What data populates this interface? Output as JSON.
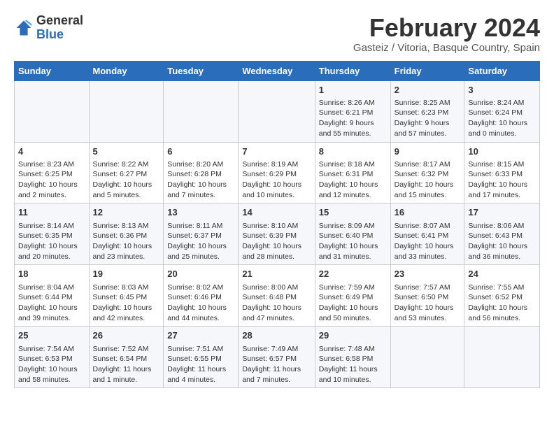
{
  "header": {
    "logo": {
      "general": "General",
      "blue": "Blue"
    },
    "title": "February 2024",
    "location": "Gasteiz / Vitoria, Basque Country, Spain"
  },
  "weekdays": [
    "Sunday",
    "Monday",
    "Tuesday",
    "Wednesday",
    "Thursday",
    "Friday",
    "Saturday"
  ],
  "weeks": [
    [
      {
        "day": "",
        "info": ""
      },
      {
        "day": "",
        "info": ""
      },
      {
        "day": "",
        "info": ""
      },
      {
        "day": "",
        "info": ""
      },
      {
        "day": "1",
        "info": "Sunrise: 8:26 AM\nSunset: 6:21 PM\nDaylight: 9 hours\nand 55 minutes."
      },
      {
        "day": "2",
        "info": "Sunrise: 8:25 AM\nSunset: 6:23 PM\nDaylight: 9 hours\nand 57 minutes."
      },
      {
        "day": "3",
        "info": "Sunrise: 8:24 AM\nSunset: 6:24 PM\nDaylight: 10 hours\nand 0 minutes."
      }
    ],
    [
      {
        "day": "4",
        "info": "Sunrise: 8:23 AM\nSunset: 6:25 PM\nDaylight: 10 hours\nand 2 minutes."
      },
      {
        "day": "5",
        "info": "Sunrise: 8:22 AM\nSunset: 6:27 PM\nDaylight: 10 hours\nand 5 minutes."
      },
      {
        "day": "6",
        "info": "Sunrise: 8:20 AM\nSunset: 6:28 PM\nDaylight: 10 hours\nand 7 minutes."
      },
      {
        "day": "7",
        "info": "Sunrise: 8:19 AM\nSunset: 6:29 PM\nDaylight: 10 hours\nand 10 minutes."
      },
      {
        "day": "8",
        "info": "Sunrise: 8:18 AM\nSunset: 6:31 PM\nDaylight: 10 hours\nand 12 minutes."
      },
      {
        "day": "9",
        "info": "Sunrise: 8:17 AM\nSunset: 6:32 PM\nDaylight: 10 hours\nand 15 minutes."
      },
      {
        "day": "10",
        "info": "Sunrise: 8:15 AM\nSunset: 6:33 PM\nDaylight: 10 hours\nand 17 minutes."
      }
    ],
    [
      {
        "day": "11",
        "info": "Sunrise: 8:14 AM\nSunset: 6:35 PM\nDaylight: 10 hours\nand 20 minutes."
      },
      {
        "day": "12",
        "info": "Sunrise: 8:13 AM\nSunset: 6:36 PM\nDaylight: 10 hours\nand 23 minutes."
      },
      {
        "day": "13",
        "info": "Sunrise: 8:11 AM\nSunset: 6:37 PM\nDaylight: 10 hours\nand 25 minutes."
      },
      {
        "day": "14",
        "info": "Sunrise: 8:10 AM\nSunset: 6:39 PM\nDaylight: 10 hours\nand 28 minutes."
      },
      {
        "day": "15",
        "info": "Sunrise: 8:09 AM\nSunset: 6:40 PM\nDaylight: 10 hours\nand 31 minutes."
      },
      {
        "day": "16",
        "info": "Sunrise: 8:07 AM\nSunset: 6:41 PM\nDaylight: 10 hours\nand 33 minutes."
      },
      {
        "day": "17",
        "info": "Sunrise: 8:06 AM\nSunset: 6:43 PM\nDaylight: 10 hours\nand 36 minutes."
      }
    ],
    [
      {
        "day": "18",
        "info": "Sunrise: 8:04 AM\nSunset: 6:44 PM\nDaylight: 10 hours\nand 39 minutes."
      },
      {
        "day": "19",
        "info": "Sunrise: 8:03 AM\nSunset: 6:45 PM\nDaylight: 10 hours\nand 42 minutes."
      },
      {
        "day": "20",
        "info": "Sunrise: 8:02 AM\nSunset: 6:46 PM\nDaylight: 10 hours\nand 44 minutes."
      },
      {
        "day": "21",
        "info": "Sunrise: 8:00 AM\nSunset: 6:48 PM\nDaylight: 10 hours\nand 47 minutes."
      },
      {
        "day": "22",
        "info": "Sunrise: 7:59 AM\nSunset: 6:49 PM\nDaylight: 10 hours\nand 50 minutes."
      },
      {
        "day": "23",
        "info": "Sunrise: 7:57 AM\nSunset: 6:50 PM\nDaylight: 10 hours\nand 53 minutes."
      },
      {
        "day": "24",
        "info": "Sunrise: 7:55 AM\nSunset: 6:52 PM\nDaylight: 10 hours\nand 56 minutes."
      }
    ],
    [
      {
        "day": "25",
        "info": "Sunrise: 7:54 AM\nSunset: 6:53 PM\nDaylight: 10 hours\nand 58 minutes."
      },
      {
        "day": "26",
        "info": "Sunrise: 7:52 AM\nSunset: 6:54 PM\nDaylight: 11 hours\nand 1 minute."
      },
      {
        "day": "27",
        "info": "Sunrise: 7:51 AM\nSunset: 6:55 PM\nDaylight: 11 hours\nand 4 minutes."
      },
      {
        "day": "28",
        "info": "Sunrise: 7:49 AM\nSunset: 6:57 PM\nDaylight: 11 hours\nand 7 minutes."
      },
      {
        "day": "29",
        "info": "Sunrise: 7:48 AM\nSunset: 6:58 PM\nDaylight: 11 hours\nand 10 minutes."
      },
      {
        "day": "",
        "info": ""
      },
      {
        "day": "",
        "info": ""
      }
    ]
  ]
}
